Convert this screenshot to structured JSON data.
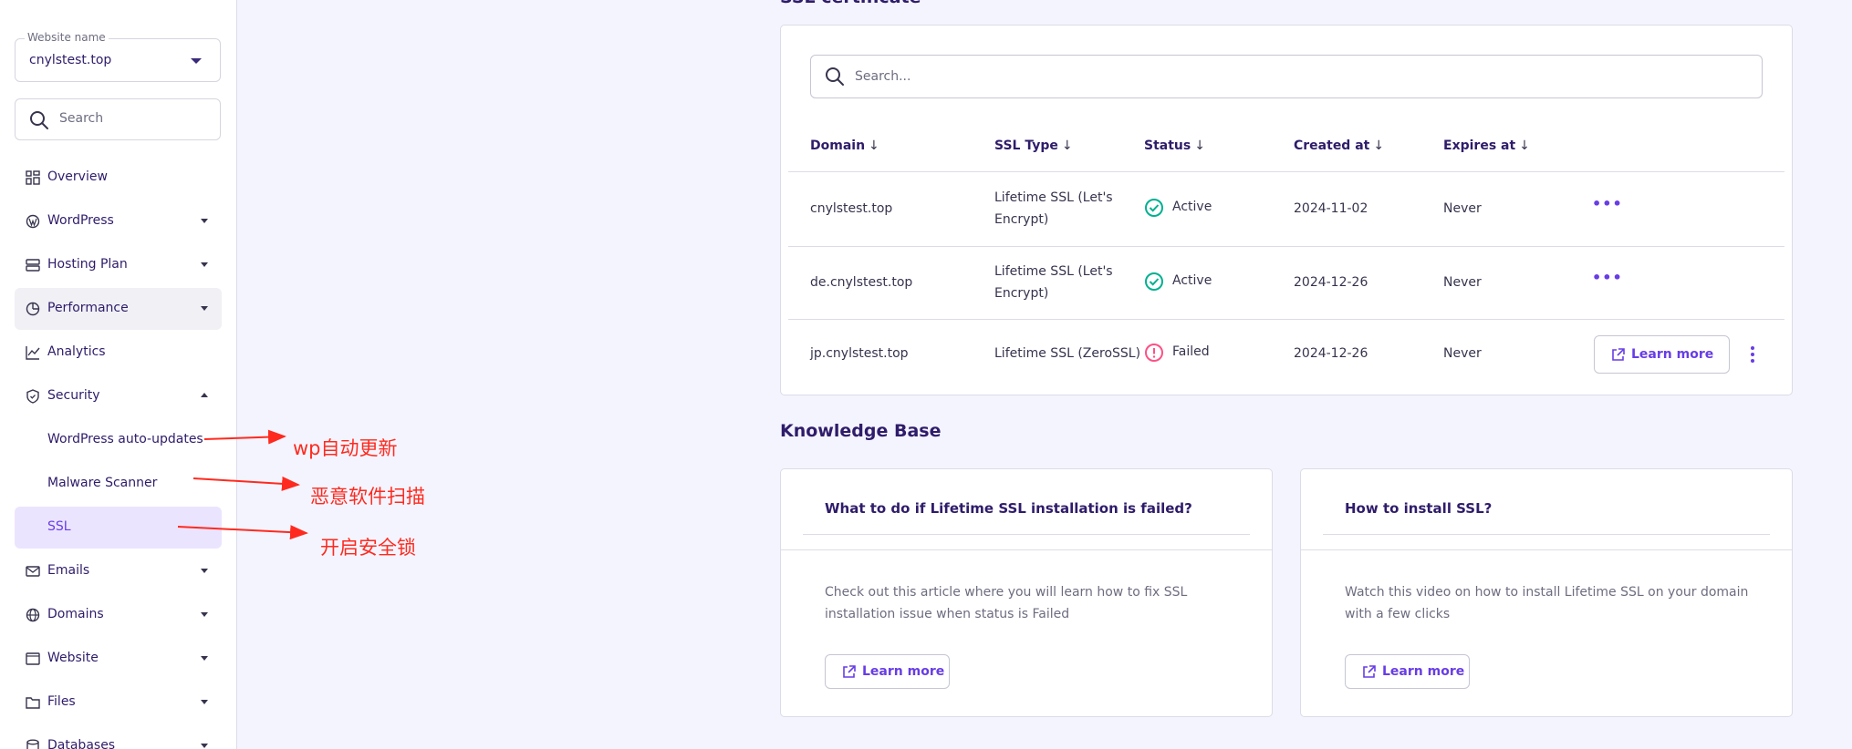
{
  "sidebar": {
    "website_select": {
      "label": "Website name",
      "value": "cnylstest.top"
    },
    "search_placeholder": "Search",
    "items": [
      {
        "label": "Overview",
        "icon": "grid-icon"
      },
      {
        "label": "WordPress",
        "icon": "wordpress-icon"
      },
      {
        "label": "Hosting Plan",
        "icon": "server-icon"
      },
      {
        "label": "Performance",
        "icon": "gauge-icon"
      },
      {
        "label": "Analytics",
        "icon": "chart-line-icon"
      },
      {
        "label": "Security",
        "icon": "shield-icon"
      },
      {
        "label": "WordPress auto-updates"
      },
      {
        "label": "Malware Scanner"
      },
      {
        "label": "SSL"
      },
      {
        "label": "Emails",
        "icon": "mail-icon"
      },
      {
        "label": "Domains",
        "icon": "globe-icon"
      },
      {
        "label": "Website",
        "icon": "browser-icon"
      },
      {
        "label": "Files",
        "icon": "folder-icon"
      },
      {
        "label": "Databases",
        "icon": "database-icon"
      }
    ]
  },
  "annotations": [
    "wp自动更新",
    "恶意软件扫描",
    "开启安全锁"
  ],
  "ssl": {
    "title": "SSL certificate",
    "search_placeholder": "Search...",
    "columns": [
      "Domain",
      "SSL Type",
      "Status",
      "Created at",
      "Expires at"
    ],
    "rows": [
      {
        "domain": "cnylstest.top",
        "type_line1": "Lifetime SSL (Let's",
        "type_line2": "Encrypt)",
        "status": "Active",
        "created": "2024-11-02",
        "expires": "Never"
      },
      {
        "domain": "de.cnylstest.top",
        "type_line1": "Lifetime SSL (Let's",
        "type_line2": "Encrypt)",
        "status": "Active",
        "created": "2024-12-26",
        "expires": "Never"
      },
      {
        "domain": "jp.cnylstest.top",
        "type_line1": "Lifetime SSL (ZeroSSL)",
        "type_line2": "",
        "status": "Failed",
        "created": "2024-12-26",
        "expires": "Never",
        "action": "Learn more"
      }
    ]
  },
  "knowledge_base": {
    "title": "Knowledge Base",
    "cards": [
      {
        "title": "What to do if Lifetime SSL installation is failed?",
        "desc": "Check out this article where you will learn how to fix SSL installation issue when status is Failed",
        "button": "Learn more"
      },
      {
        "title": "How to install SSL?",
        "desc": "Watch this video on how to install Lifetime SSL on your domain with a few clicks",
        "button": "Learn more"
      }
    ]
  },
  "colors": {
    "accent": "#673de6",
    "active": "#00b090",
    "failed": "#fc5185",
    "annotation": "#ff2a1f"
  }
}
